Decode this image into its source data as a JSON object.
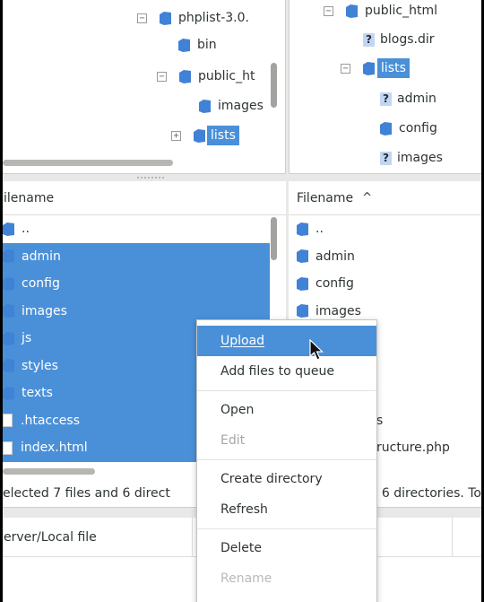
{
  "remote_tree_left": {
    "items": [
      {
        "label": "phplist-3.0.",
        "indent": 0
      },
      {
        "label": "bin"
      },
      {
        "label": "public_ht"
      },
      {
        "label": "images"
      },
      {
        "label": "lists"
      }
    ]
  },
  "remote_tree_right": {
    "items": [
      {
        "label": "public_html"
      },
      {
        "label": "blogs.dir"
      },
      {
        "label": "lists"
      },
      {
        "label": "admin"
      },
      {
        "label": "config"
      },
      {
        "label": "images"
      }
    ]
  },
  "left_list": {
    "header": "ilename",
    "rows": [
      "..",
      "admin",
      "config",
      "images",
      "js",
      "styles",
      "texts",
      ".htaccess",
      "index.html"
    ],
    "status": "elected 7 files and 6 direct"
  },
  "right_list": {
    "header": "Filename",
    "sort_icon": "chevron-up-icon",
    "rows": [
      "..",
      "admin",
      "config",
      "images",
      "",
      "",
      "",
      "s",
      "ructure.php"
    ],
    "status": "6 directories. To"
  },
  "queue": {
    "col1": "erver/Local file"
  },
  "context_menu": {
    "items": [
      {
        "label": "Upload",
        "mnemonic": "U",
        "state": "active"
      },
      {
        "label": "Add files to queue",
        "mnemonic": "A",
        "state": "normal"
      },
      {
        "label": "Open",
        "mnemonic": "O",
        "state": "normal"
      },
      {
        "label": "Edit",
        "state": "disabled"
      },
      {
        "label": "Create directory",
        "mnemonic": "C",
        "state": "normal"
      },
      {
        "label": "Refresh",
        "mnemonic": "f",
        "state": "normal"
      },
      {
        "label": "Delete",
        "mnemonic": "D",
        "state": "normal"
      },
      {
        "label": "Rename",
        "state": "normal"
      }
    ]
  },
  "colors": {
    "selection": "#4a90d9",
    "folder": "#3f82d6",
    "disabled_text": "#a5a7a3"
  }
}
